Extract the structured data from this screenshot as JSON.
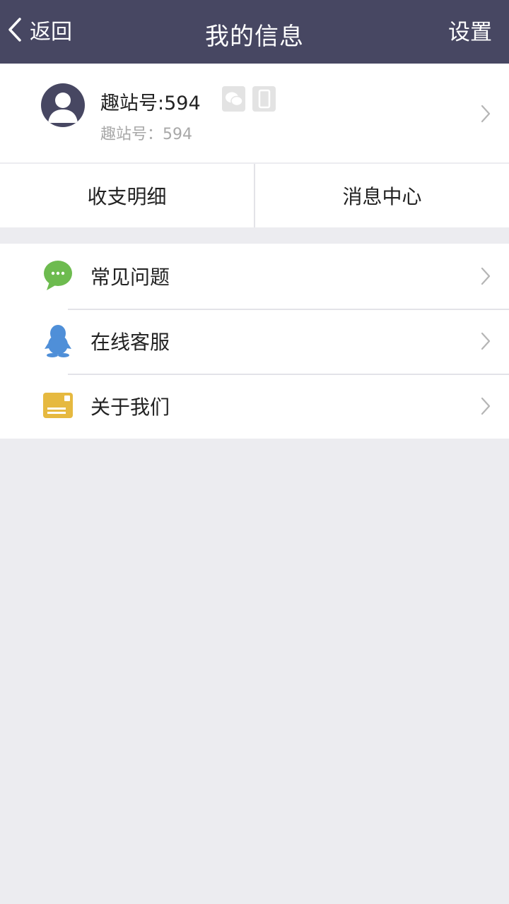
{
  "header": {
    "back_label": "返回",
    "title": "我的信息",
    "settings_label": "设置",
    "background": "#474762"
  },
  "profile": {
    "name": "趣站号:594",
    "subtitle": "趣站号：594",
    "bind_icons": [
      "wechat-icon",
      "phone-icon"
    ]
  },
  "quick_links": [
    {
      "label": "收支明细"
    },
    {
      "label": "消息中心"
    }
  ],
  "menu": [
    {
      "label": "常见问题",
      "icon": "chat-bubble-icon",
      "color": "#6dbb4f"
    },
    {
      "label": "在线客服",
      "icon": "qq-penguin-icon",
      "color": "#4f8fd8"
    },
    {
      "label": "关于我们",
      "icon": "info-card-icon",
      "color": "#e6b940"
    }
  ]
}
